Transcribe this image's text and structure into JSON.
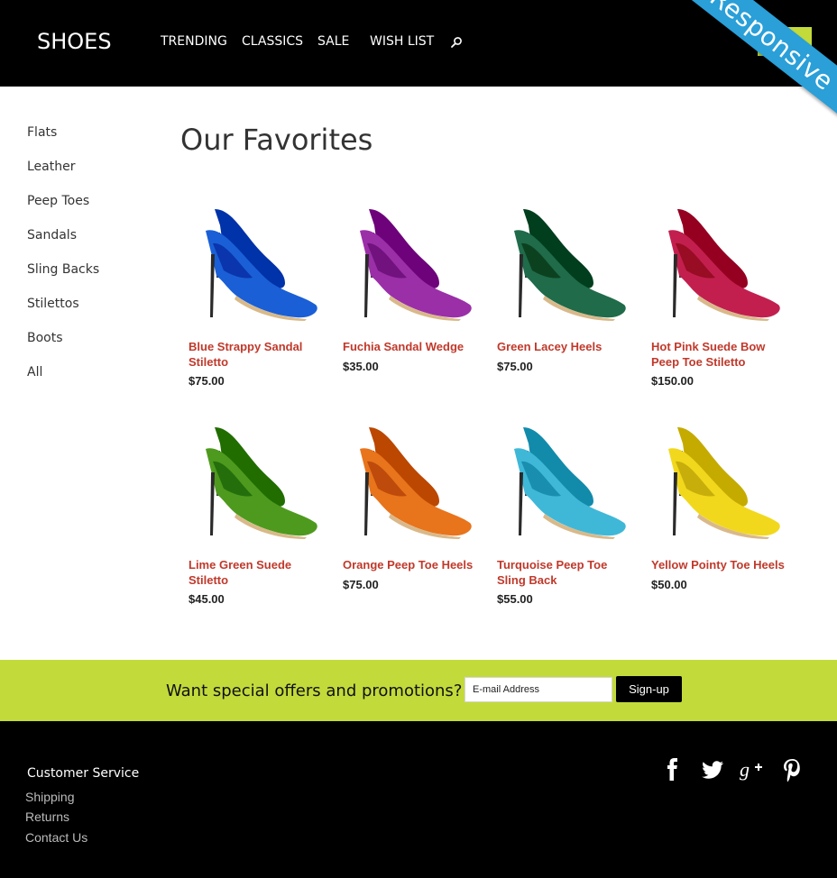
{
  "header": {
    "logo": "SHOES",
    "nav": [
      "TRENDING",
      "CLASSICS",
      "SALE",
      "WISH LIST"
    ],
    "ribbon": "Responsive",
    "cart_label": "T",
    "accent": "#c3da3b"
  },
  "sidebar": {
    "items": [
      "Flats",
      "Leather",
      "Peep Toes",
      "Sandals",
      "Sling Backs",
      "Stilettos",
      "Boots",
      "All"
    ]
  },
  "main": {
    "title": "Our Favorites",
    "products": [
      {
        "name": "Blue Strappy Sandal Stiletto",
        "price": "$75.00",
        "color": "#1a5fd6"
      },
      {
        "name": "Fuchia Sandal Wedge",
        "price": "$35.00",
        "color": "#9b2fa8"
      },
      {
        "name": "Green Lacey Heels",
        "price": "$75.00",
        "color": "#1f6b4a"
      },
      {
        "name": "Hot Pink Suede Bow Peep Toe Stiletto",
        "price": "$150.00",
        "color": "#c21f4e"
      },
      {
        "name": "Lime Green Suede Stiletto",
        "price": "$45.00",
        "color": "#4e9a1e"
      },
      {
        "name": "Orange Peep Toe Heels",
        "price": "$75.00",
        "color": "#e8741c"
      },
      {
        "name": "Turquoise Peep Toe Sling Back",
        "price": "$55.00",
        "color": "#3fb8d8"
      },
      {
        "name": "Yellow Pointy Toe Heels",
        "price": "$50.00",
        "color": "#f2d81c"
      }
    ]
  },
  "promo": {
    "text": "Want special offers and promotions?",
    "email_placeholder": "E-mail Address",
    "signup_label": "Sign-up"
  },
  "footer": {
    "heading": "Customer Service",
    "links": [
      "Shipping",
      "Returns",
      "Contact Us"
    ],
    "social": [
      "facebook-icon",
      "twitter-icon",
      "google-plus-icon",
      "pinterest-icon"
    ]
  }
}
